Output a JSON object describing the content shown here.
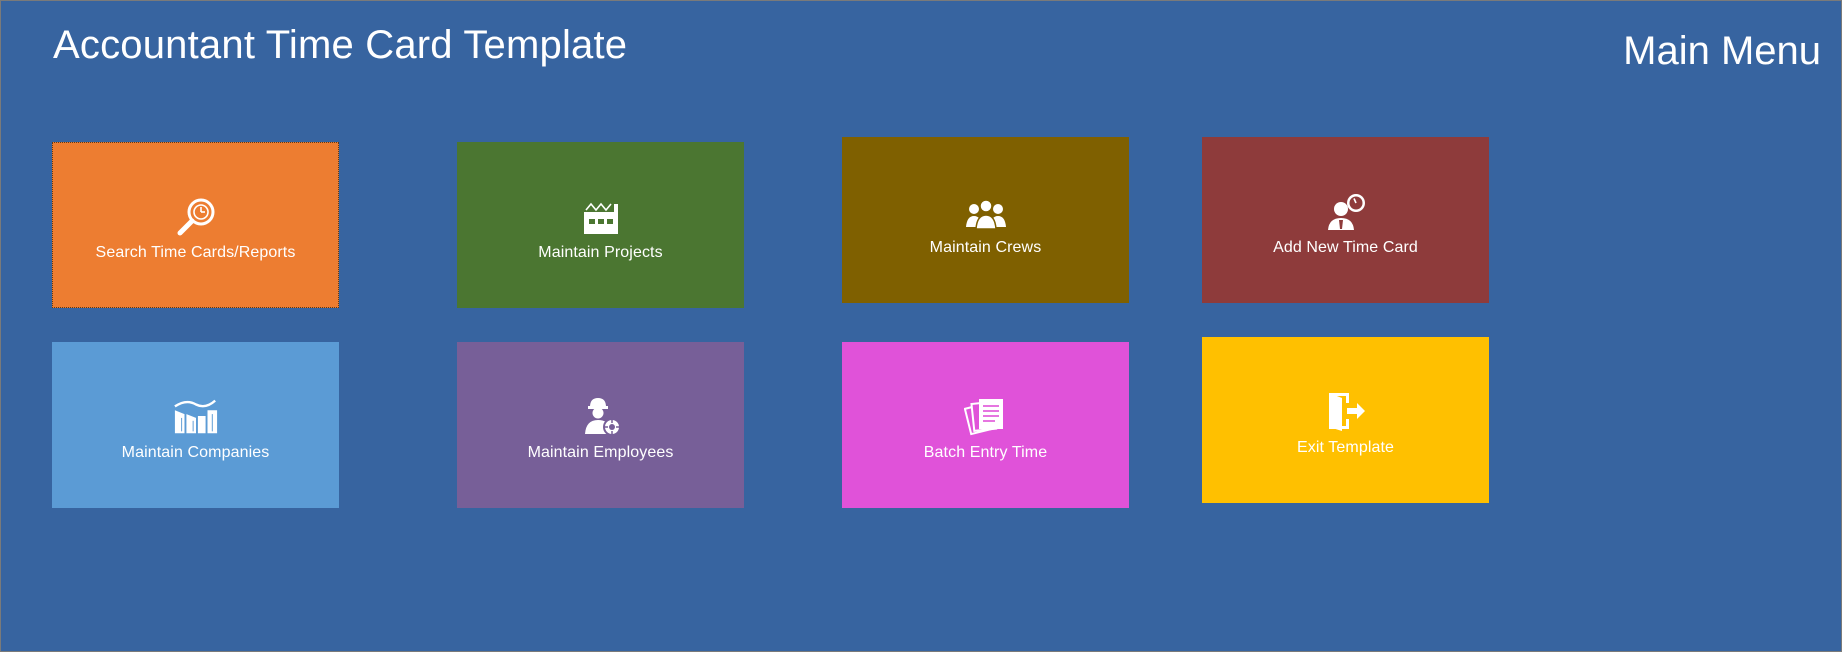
{
  "header": {
    "app_title": "Accountant Time Card Template",
    "menu_title": "Main Menu"
  },
  "tiles": [
    {
      "label": "Search Time Cards/Reports",
      "color": "#ed7d31",
      "icon": "search-clock-icon"
    },
    {
      "label": "Maintain Projects",
      "color": "#4b7631",
      "icon": "factory-icon"
    },
    {
      "label": "Maintain Crews",
      "color": "#7f6000",
      "icon": "group-icon"
    },
    {
      "label": "Add New Time Card",
      "color": "#8e3b3b",
      "icon": "person-clock-icon"
    },
    {
      "label": "Maintain Companies",
      "color": "#5b9bd5",
      "icon": "buildings-icon"
    },
    {
      "label": "Maintain Employees",
      "color": "#775f98",
      "icon": "worker-gear-icon"
    },
    {
      "label": "Batch Entry Time",
      "color": "#e052d9",
      "icon": "documents-icon"
    },
    {
      "label": "Exit Template",
      "color": "#ffc000",
      "icon": "exit-door-icon"
    }
  ],
  "colors": {
    "background": "#3764a0",
    "text": "#ffffff"
  }
}
